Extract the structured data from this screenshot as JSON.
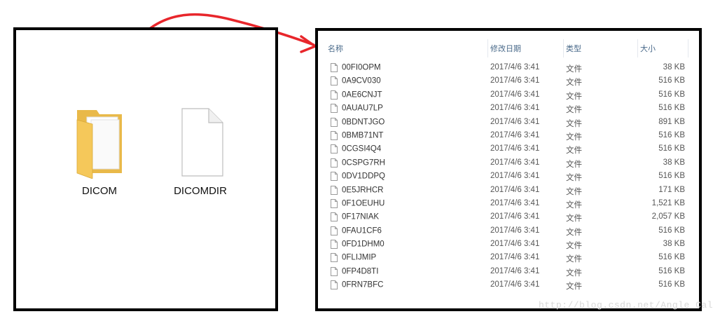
{
  "left": {
    "items": [
      {
        "label": "DICOM",
        "icon": "folder-icon"
      },
      {
        "label": "DICOMDIR",
        "icon": "file-icon"
      }
    ]
  },
  "right": {
    "headers": {
      "name": "名称",
      "date": "修改日期",
      "type": "类型",
      "size": "大小"
    },
    "rows": [
      {
        "name": "00FI0OPM",
        "date": "2017/4/6 3:41",
        "type": "文件",
        "size": "38 KB"
      },
      {
        "name": "0A9CV030",
        "date": "2017/4/6 3:41",
        "type": "文件",
        "size": "516 KB"
      },
      {
        "name": "0AE6CNJT",
        "date": "2017/4/6 3:41",
        "type": "文件",
        "size": "516 KB"
      },
      {
        "name": "0AUAU7LP",
        "date": "2017/4/6 3:41",
        "type": "文件",
        "size": "516 KB"
      },
      {
        "name": "0BDNTJGO",
        "date": "2017/4/6 3:41",
        "type": "文件",
        "size": "891 KB"
      },
      {
        "name": "0BMB71NT",
        "date": "2017/4/6 3:41",
        "type": "文件",
        "size": "516 KB"
      },
      {
        "name": "0CGSI4Q4",
        "date": "2017/4/6 3:41",
        "type": "文件",
        "size": "516 KB"
      },
      {
        "name": "0CSPG7RH",
        "date": "2017/4/6 3:41",
        "type": "文件",
        "size": "38 KB"
      },
      {
        "name": "0DV1DDPQ",
        "date": "2017/4/6 3:41",
        "type": "文件",
        "size": "516 KB"
      },
      {
        "name": "0E5JRHCR",
        "date": "2017/4/6 3:41",
        "type": "文件",
        "size": "171 KB"
      },
      {
        "name": "0F1OEUHU",
        "date": "2017/4/6 3:41",
        "type": "文件",
        "size": "1,521 KB"
      },
      {
        "name": "0F17NIAK",
        "date": "2017/4/6 3:41",
        "type": "文件",
        "size": "2,057 KB"
      },
      {
        "name": "0FAU1CF6",
        "date": "2017/4/6 3:41",
        "type": "文件",
        "size": "516 KB"
      },
      {
        "name": "0FD1DHM0",
        "date": "2017/4/6 3:41",
        "type": "文件",
        "size": "38 KB"
      },
      {
        "name": "0FLIJMIP",
        "date": "2017/4/6 3:41",
        "type": "文件",
        "size": "516 KB"
      },
      {
        "name": "0FP4D8TI",
        "date": "2017/4/6 3:41",
        "type": "文件",
        "size": "516 KB"
      },
      {
        "name": "0FRN7BFC",
        "date": "2017/4/6 3:41",
        "type": "文件",
        "size": "516 KB"
      }
    ]
  },
  "watermark": "http://blog.csdn.net/Angle Cal",
  "colors": {
    "arrow": "#e8262b",
    "folder": "#f5c85a",
    "header_text": "#4a6a8a"
  }
}
